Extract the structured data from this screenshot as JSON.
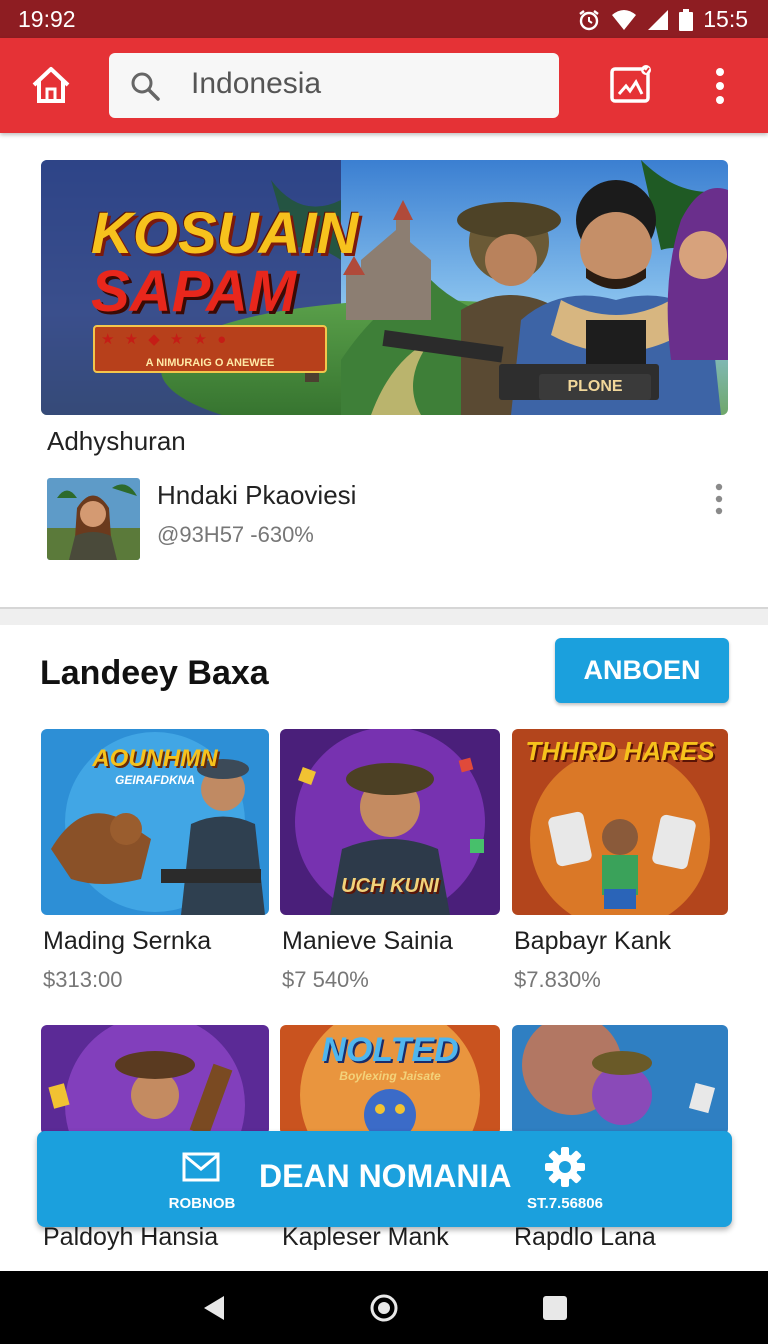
{
  "status_bar": {
    "time_left": "19:92",
    "time_right": "15:5"
  },
  "app_bar": {
    "search_text": "Indonesia"
  },
  "featured": {
    "banner_title_line1": "KOSUAIN",
    "banner_title_line2": "SAPAM",
    "banner_tagline": "A NIMURAIG O ANEWEE",
    "banner_gun_label": "PLONE",
    "label": "Adhyshuran",
    "item_name": "Hndaki Pkaoviesi",
    "item_meta": "@93Η57 -630%"
  },
  "section": {
    "title": "Landeey Baxa",
    "button_label": "ANBOEN"
  },
  "games": [
    {
      "name": "Mading Sernka",
      "price": "$313:00",
      "art_label": "AOUNHMN",
      "art_sub": "GEIRAFDKNA"
    },
    {
      "name": "Manieve Sainia",
      "price": "$7 540%",
      "art_label": "UCH KUNI",
      "art_sub": ""
    },
    {
      "name": "Bapbayr Kank",
      "price": "$7.830%",
      "art_label": "THHRD HARES",
      "art_sub": ""
    },
    {
      "name": "Paldoyh Hansia",
      "price": "",
      "art_label": "",
      "art_sub": ""
    },
    {
      "name": "Kapleser Mank",
      "price": "",
      "art_label": "NOLTED",
      "art_sub": "Boylexing Jaisate"
    },
    {
      "name": "Rapdlo Lana",
      "price": "",
      "art_label": "",
      "art_sub": ""
    }
  ],
  "bottom_panel": {
    "left_label": "ROBNOB",
    "center_label": "DEAN NOMANIA",
    "right_label": "ST.7.56806"
  },
  "colors": {
    "app_bar": "#e53236",
    "status_bar": "#8e1d22",
    "accent_blue": "#1ba0dd"
  },
  "icons": {
    "home": "home-icon",
    "search": "search-icon",
    "cast": "cast-icon",
    "more": "more-vert-icon",
    "mail": "mail-icon",
    "settings": "gear-icon"
  }
}
